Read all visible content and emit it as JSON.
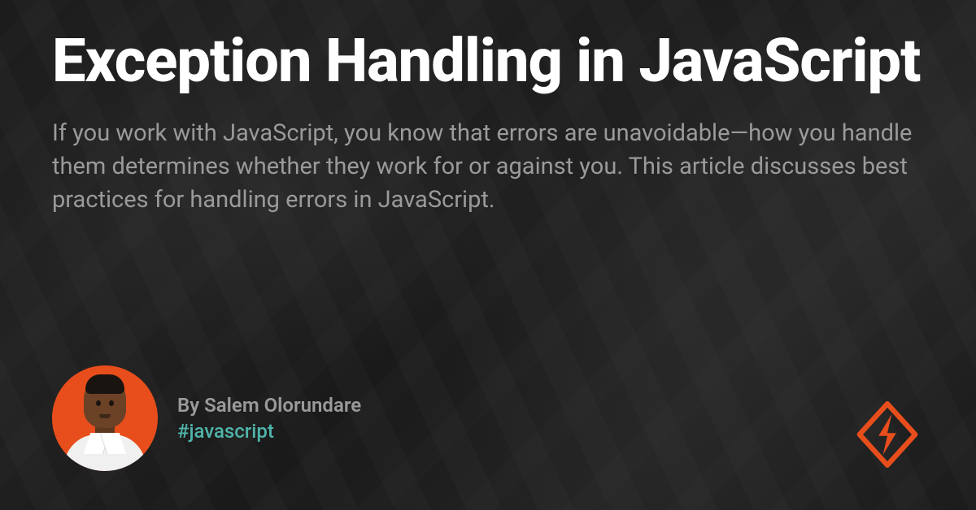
{
  "title": "Exception Handling in JavaScript",
  "description": "If you work with JavaScript, you know that errors are unavoidable—how you handle them determines whether they work for or against you. This article discusses best practices for handling errors in JavaScript.",
  "author": {
    "prefix": "By ",
    "name": "Salem Olorundare",
    "hashtag": "#javascript"
  },
  "colors": {
    "accent": "#e84e1c",
    "hashtag": "#4fb3a9",
    "background": "#1a1a1a",
    "text_primary": "#ffffff",
    "text_secondary": "#9a9a9a"
  }
}
